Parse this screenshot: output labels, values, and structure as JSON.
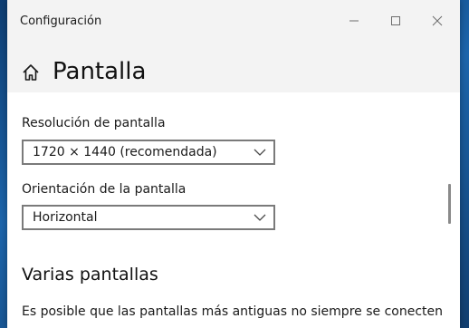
{
  "window": {
    "app_title": "Configuración"
  },
  "header": {
    "page_title": "Pantalla"
  },
  "display": {
    "resolution": {
      "label": "Resolución de pantalla",
      "selected": "1720 × 1440 (recomendada)"
    },
    "orientation": {
      "label": "Orientación de la pantalla",
      "selected": "Horizontal"
    }
  },
  "multiple_displays": {
    "title": "Varias pantallas",
    "description": "Es posible que las pantallas más antiguas no siempre se conecten"
  },
  "icons": {
    "home": "home-icon",
    "minimize": "minimize-icon",
    "maximize": "maximize-icon",
    "close": "close-icon",
    "chevron": "chevron-down-icon"
  }
}
